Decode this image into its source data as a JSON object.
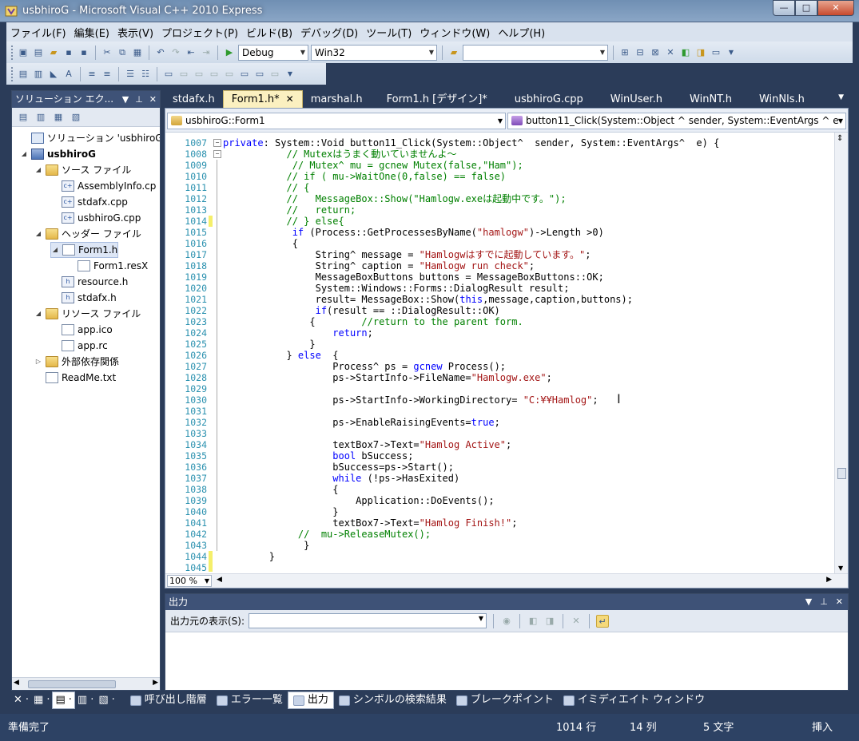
{
  "window": {
    "title": "usbhiroG - Microsoft Visual C++ 2010 Express",
    "controls": [
      "—",
      "□",
      "✕"
    ]
  },
  "menu": [
    "ファイル(F)",
    "編集(E)",
    "表示(V)",
    "プロジェクト(P)",
    "ビルド(B)",
    "デバッグ(D)",
    "ツール(T)",
    "ウィンドウ(W)",
    "ヘルプ(H)"
  ],
  "toolbar": {
    "config": "Debug",
    "platform": "Win32",
    "find_value": ""
  },
  "solution_explorer": {
    "title": "ソリューション エク...",
    "tree": [
      {
        "label": "ソリューション 'usbhiroG' (",
        "icon": "solution-icon",
        "exp": ""
      },
      {
        "label": "usbhiroG",
        "icon": "project-icon",
        "exp": "◢"
      },
      {
        "label": "ソース ファイル",
        "icon": "folder-icon",
        "exp": "◢"
      },
      {
        "label": "AssemblyInfo.cp",
        "icon": "cpp-file-icon",
        "exp": ""
      },
      {
        "label": "stdafx.cpp",
        "icon": "cpp-file-icon",
        "exp": ""
      },
      {
        "label": "usbhiroG.cpp",
        "icon": "cpp-file-icon",
        "exp": ""
      },
      {
        "label": "ヘッダー ファイル",
        "icon": "folder-icon",
        "exp": "◢"
      },
      {
        "label": "Form1.h",
        "icon": "form-icon",
        "exp": "◢"
      },
      {
        "label": "Form1.resX",
        "icon": "resx-icon",
        "exp": ""
      },
      {
        "label": "resource.h",
        "icon": "header-file-icon",
        "exp": ""
      },
      {
        "label": "stdafx.h",
        "icon": "header-file-icon",
        "exp": ""
      },
      {
        "label": "リソース ファイル",
        "icon": "folder-icon",
        "exp": "◢"
      },
      {
        "label": "app.ico",
        "icon": "image-file-icon",
        "exp": ""
      },
      {
        "label": "app.rc",
        "icon": "rc-file-icon",
        "exp": ""
      },
      {
        "label": "外部依存関係",
        "icon": "folder-icon",
        "exp": "▷"
      },
      {
        "label": "ReadMe.txt",
        "icon": "text-file-icon",
        "exp": ""
      }
    ]
  },
  "tabs": [
    "stdafx.h",
    "Form1.h*",
    "marshal.h",
    "Form1.h [デザイン]*",
    "usbhiroG.cpp",
    "WinUser.h",
    "WinNT.h",
    "WinNls.h"
  ],
  "editor": {
    "scope_combo": "usbhiroG::Form1",
    "member_combo": "button11_Click(System::Object ^ sender, System::EventArgs ^ e",
    "zoom": "100 %",
    "lines": [
      {
        "n": "1007",
        "t": "private: System::Void button11_Click(System::Object^  sender, System::EventArgs^  e) {"
      },
      {
        "n": "1008",
        "t": "           // Mutexはうまく動いていませんよ～"
      },
      {
        "n": "1009",
        "t": "            // Mutex^ mu = gcnew Mutex(false,\"Ham\");"
      },
      {
        "n": "1010",
        "t": "           // if ( mu->WaitOne(0,false) == false)"
      },
      {
        "n": "1011",
        "t": "           // {"
      },
      {
        "n": "1012",
        "t": "           //   MessageBox::Show(\"Hamlogw.exeは起動中です。\");"
      },
      {
        "n": "1013",
        "t": "           //   return;"
      },
      {
        "n": "1014",
        "t": "           // } else{"
      },
      {
        "n": "1015",
        "t": "            if (Process::GetProcessesByName(\"hamlogw\")->Length >0)"
      },
      {
        "n": "1016",
        "t": "            {"
      },
      {
        "n": "1017",
        "t": "                String^ message = \"Hamlogwはすでに起動しています。\";"
      },
      {
        "n": "1018",
        "t": "                String^ caption = \"Hamlogw run check\";"
      },
      {
        "n": "1019",
        "t": "                MessageBoxButtons buttons = MessageBoxButtons::OK;"
      },
      {
        "n": "1020",
        "t": "                System::Windows::Forms::DialogResult result;"
      },
      {
        "n": "1021",
        "t": "                result= MessageBox::Show(this,message,caption,buttons);"
      },
      {
        "n": "1022",
        "t": "                if(result == ::DialogResult::OK)"
      },
      {
        "n": "1023",
        "t": "               {        //return to the parent form."
      },
      {
        "n": "1024",
        "t": "                   return;"
      },
      {
        "n": "1025",
        "t": "               }"
      },
      {
        "n": "1026",
        "t": "           } else  {"
      },
      {
        "n": "1027",
        "t": "                   Process^ ps = gcnew Process();"
      },
      {
        "n": "1028",
        "t": "                   ps->StartInfo->FileName=\"Hamlogw.exe\";"
      },
      {
        "n": "1029",
        "t": ""
      },
      {
        "n": "1030",
        "t": "                   ps->StartInfo->WorkingDirectory= \"C:¥¥Hamlog\";"
      },
      {
        "n": "1031",
        "t": ""
      },
      {
        "n": "1032",
        "t": "                   ps->EnableRaisingEvents=true;"
      },
      {
        "n": "1033",
        "t": ""
      },
      {
        "n": "1034",
        "t": "                   textBox7->Text=\"Hamlog Active\";"
      },
      {
        "n": "1035",
        "t": "                   bool bSuccess;"
      },
      {
        "n": "1036",
        "t": "                   bSuccess=ps->Start();"
      },
      {
        "n": "1037",
        "t": "                   while (!ps->HasExited)"
      },
      {
        "n": "1038",
        "t": "                   {"
      },
      {
        "n": "1039",
        "t": "                       Application::DoEvents();"
      },
      {
        "n": "1040",
        "t": "                   }"
      },
      {
        "n": "1041",
        "t": "                   textBox7->Text=\"Hamlog Finish!\";"
      },
      {
        "n": "1042",
        "t": "             //  mu->ReleaseMutex();"
      },
      {
        "n": "1043",
        "t": "              }"
      },
      {
        "n": "1044",
        "t": "        }"
      },
      {
        "n": "1045",
        "t": ""
      }
    ]
  },
  "output": {
    "title": "出力",
    "source_label": "出力元の表示(S):",
    "source_value": ""
  },
  "bottom_tabs": [
    "呼び出し階層",
    "エラー一覧",
    "出力",
    "シンボルの検索結果",
    "ブレークポイント",
    "イミディエイト ウィンドウ"
  ],
  "status": {
    "message": "準備完了",
    "line": "1014 行",
    "col": "14 列",
    "chars": "5 文字",
    "mode": "挿入"
  }
}
